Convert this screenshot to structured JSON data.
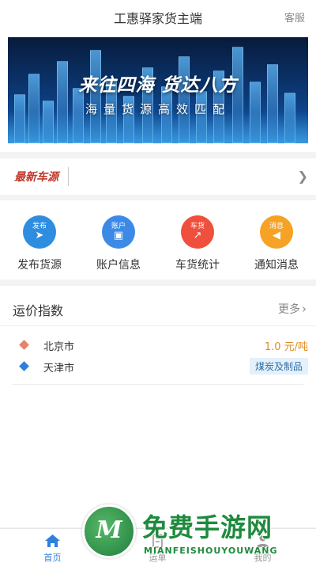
{
  "header": {
    "title": "工惠驿家货主端",
    "service_label": "客服"
  },
  "banner": {
    "slogan": "来往四海 货达八方",
    "subtitle": "海量货源高效匹配"
  },
  "news": {
    "logo_text": "最新车源",
    "arrow_icon": "chevron-right-icon"
  },
  "quick_actions": [
    {
      "label": "发布货源",
      "icon_tag": "发布",
      "icon": "paper-plane-icon",
      "color": "#2f8de0"
    },
    {
      "label": "账户信息",
      "icon_tag": "账户",
      "icon": "wallet-icon",
      "color": "#3d8ae6"
    },
    {
      "label": "车货统计",
      "icon_tag": "车货",
      "icon": "chart-up-icon",
      "color": "#ef4f3c"
    },
    {
      "label": "通知消息",
      "icon_tag": "消息",
      "icon": "speaker-icon",
      "color": "#f6a226"
    }
  ],
  "freight_index": {
    "title": "运价指数",
    "more_label": "更多",
    "from": {
      "city": "北京市",
      "marker_color": "#e8836a",
      "price": "1.0 元/吨"
    },
    "to": {
      "city": "天津市",
      "marker_color": "#2f7fdc",
      "cargo": "煤炭及制品"
    }
  },
  "tabbar": {
    "active_color": "#2f7fdc",
    "inactive_color": "#999999",
    "tabs": [
      {
        "label": "首页",
        "icon": "home-icon",
        "active": true
      },
      {
        "label": "运单",
        "icon": "document-icon",
        "active": false
      },
      {
        "label": "我的",
        "icon": "user-icon",
        "active": false
      }
    ]
  },
  "watermark": {
    "main": "免费手游网",
    "sub": "MIANFEISHOUYOUWANG",
    "badge_letter": "M"
  }
}
